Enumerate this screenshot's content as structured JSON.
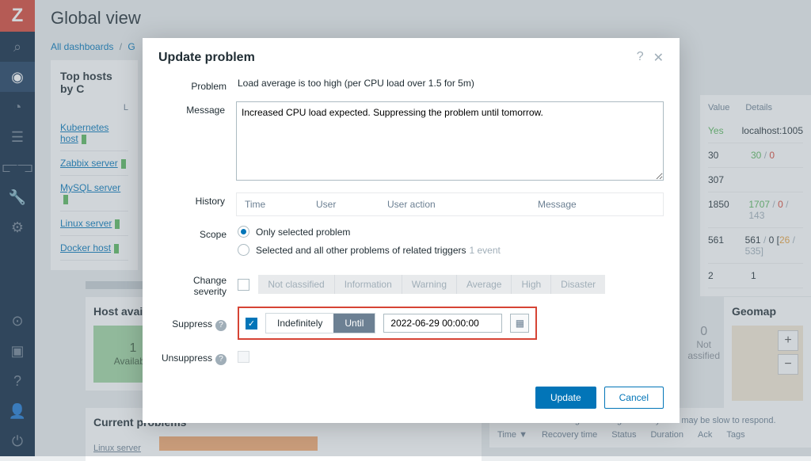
{
  "page_title": "Global view",
  "breadcrumb": {
    "all": "All dashboards",
    "sep": "/",
    "current": "G"
  },
  "sidebar_logo": "Z",
  "panels": {
    "top_hosts": {
      "title": "Top hosts by C",
      "col": "L"
    },
    "hosts": [
      "Kubernetes host",
      "Zabbix server",
      "MySQL server",
      "Linux server",
      "Docker host"
    ],
    "availability": {
      "title": "Host availability",
      "count": "1",
      "label": "Available",
      "red_label": "a"
    },
    "host_count": {
      "n": "0",
      "label1": "Not",
      "label2": "assified"
    },
    "geomap": {
      "title": "Geomap",
      "plus": "+",
      "minus": "−"
    },
    "current_problems": {
      "title": "Current problems",
      "text": "Linux server"
    },
    "prob_detail": {
      "text": "Per CPU load average is too high. Your system may be slow to respond.",
      "cols": [
        "Time ▼",
        "Recovery time",
        "Status",
        "Duration",
        "Ack",
        "Tags"
      ]
    }
  },
  "value_table": {
    "headers": [
      "Value",
      "Details"
    ],
    "rows": [
      {
        "val": "Yes",
        "val_class": "green",
        "detail": "localhost:1005"
      },
      {
        "val": "30",
        "detail_parts": [
          {
            "t": "30",
            "c": "green"
          },
          {
            "t": " / ",
            "c": "grey"
          },
          {
            "t": "0",
            "c": "red"
          }
        ]
      },
      {
        "val": "307",
        "detail": ""
      },
      {
        "val": "1850",
        "detail_parts": [
          {
            "t": "1707",
            "c": "green"
          },
          {
            "t": " / ",
            "c": "grey"
          },
          {
            "t": "0",
            "c": "red"
          },
          {
            "t": " / ",
            "c": "grey"
          },
          {
            "t": "143",
            "c": "grey"
          }
        ]
      },
      {
        "val": "561",
        "detail_parts": [
          {
            "t": "561",
            "c": ""
          },
          {
            "t": " / ",
            "c": "grey"
          },
          {
            "t": "0",
            "c": ""
          },
          {
            "t": " [",
            "c": ""
          },
          {
            "t": "26",
            "c": "orange"
          },
          {
            "t": " / ",
            "c": "grey"
          },
          {
            "t": "535",
            "c": "grey"
          },
          {
            "t": "]",
            "c": "grey"
          }
        ]
      },
      {
        "val": "2",
        "detail": "1"
      }
    ]
  },
  "modal": {
    "title": "Update problem",
    "help": "?",
    "close": "✕",
    "problem_label": "Problem",
    "problem_text": "Load average is too high (per CPU load over 1.5 for 5m)",
    "message_label": "Message",
    "message_value": "Increased CPU load expected. Suppressing the problem until tomorrow.",
    "history_label": "History",
    "history_cols": [
      "Time",
      "User",
      "User action",
      "Message"
    ],
    "scope_label": "Scope",
    "scope_opt1": "Only selected problem",
    "scope_opt2": "Selected and all other problems of related triggers",
    "scope_hint": "1 event",
    "severity_label": "Change severity",
    "severity_opts": [
      "Not classified",
      "Information",
      "Warning",
      "Average",
      "High",
      "Disaster"
    ],
    "suppress_label": "Suppress",
    "suppress_indef": "Indefinitely",
    "suppress_until": "Until",
    "suppress_date": "2022-06-29 00:00:00",
    "unsuppress_label": "Unsuppress",
    "update_btn": "Update",
    "cancel_btn": "Cancel"
  }
}
